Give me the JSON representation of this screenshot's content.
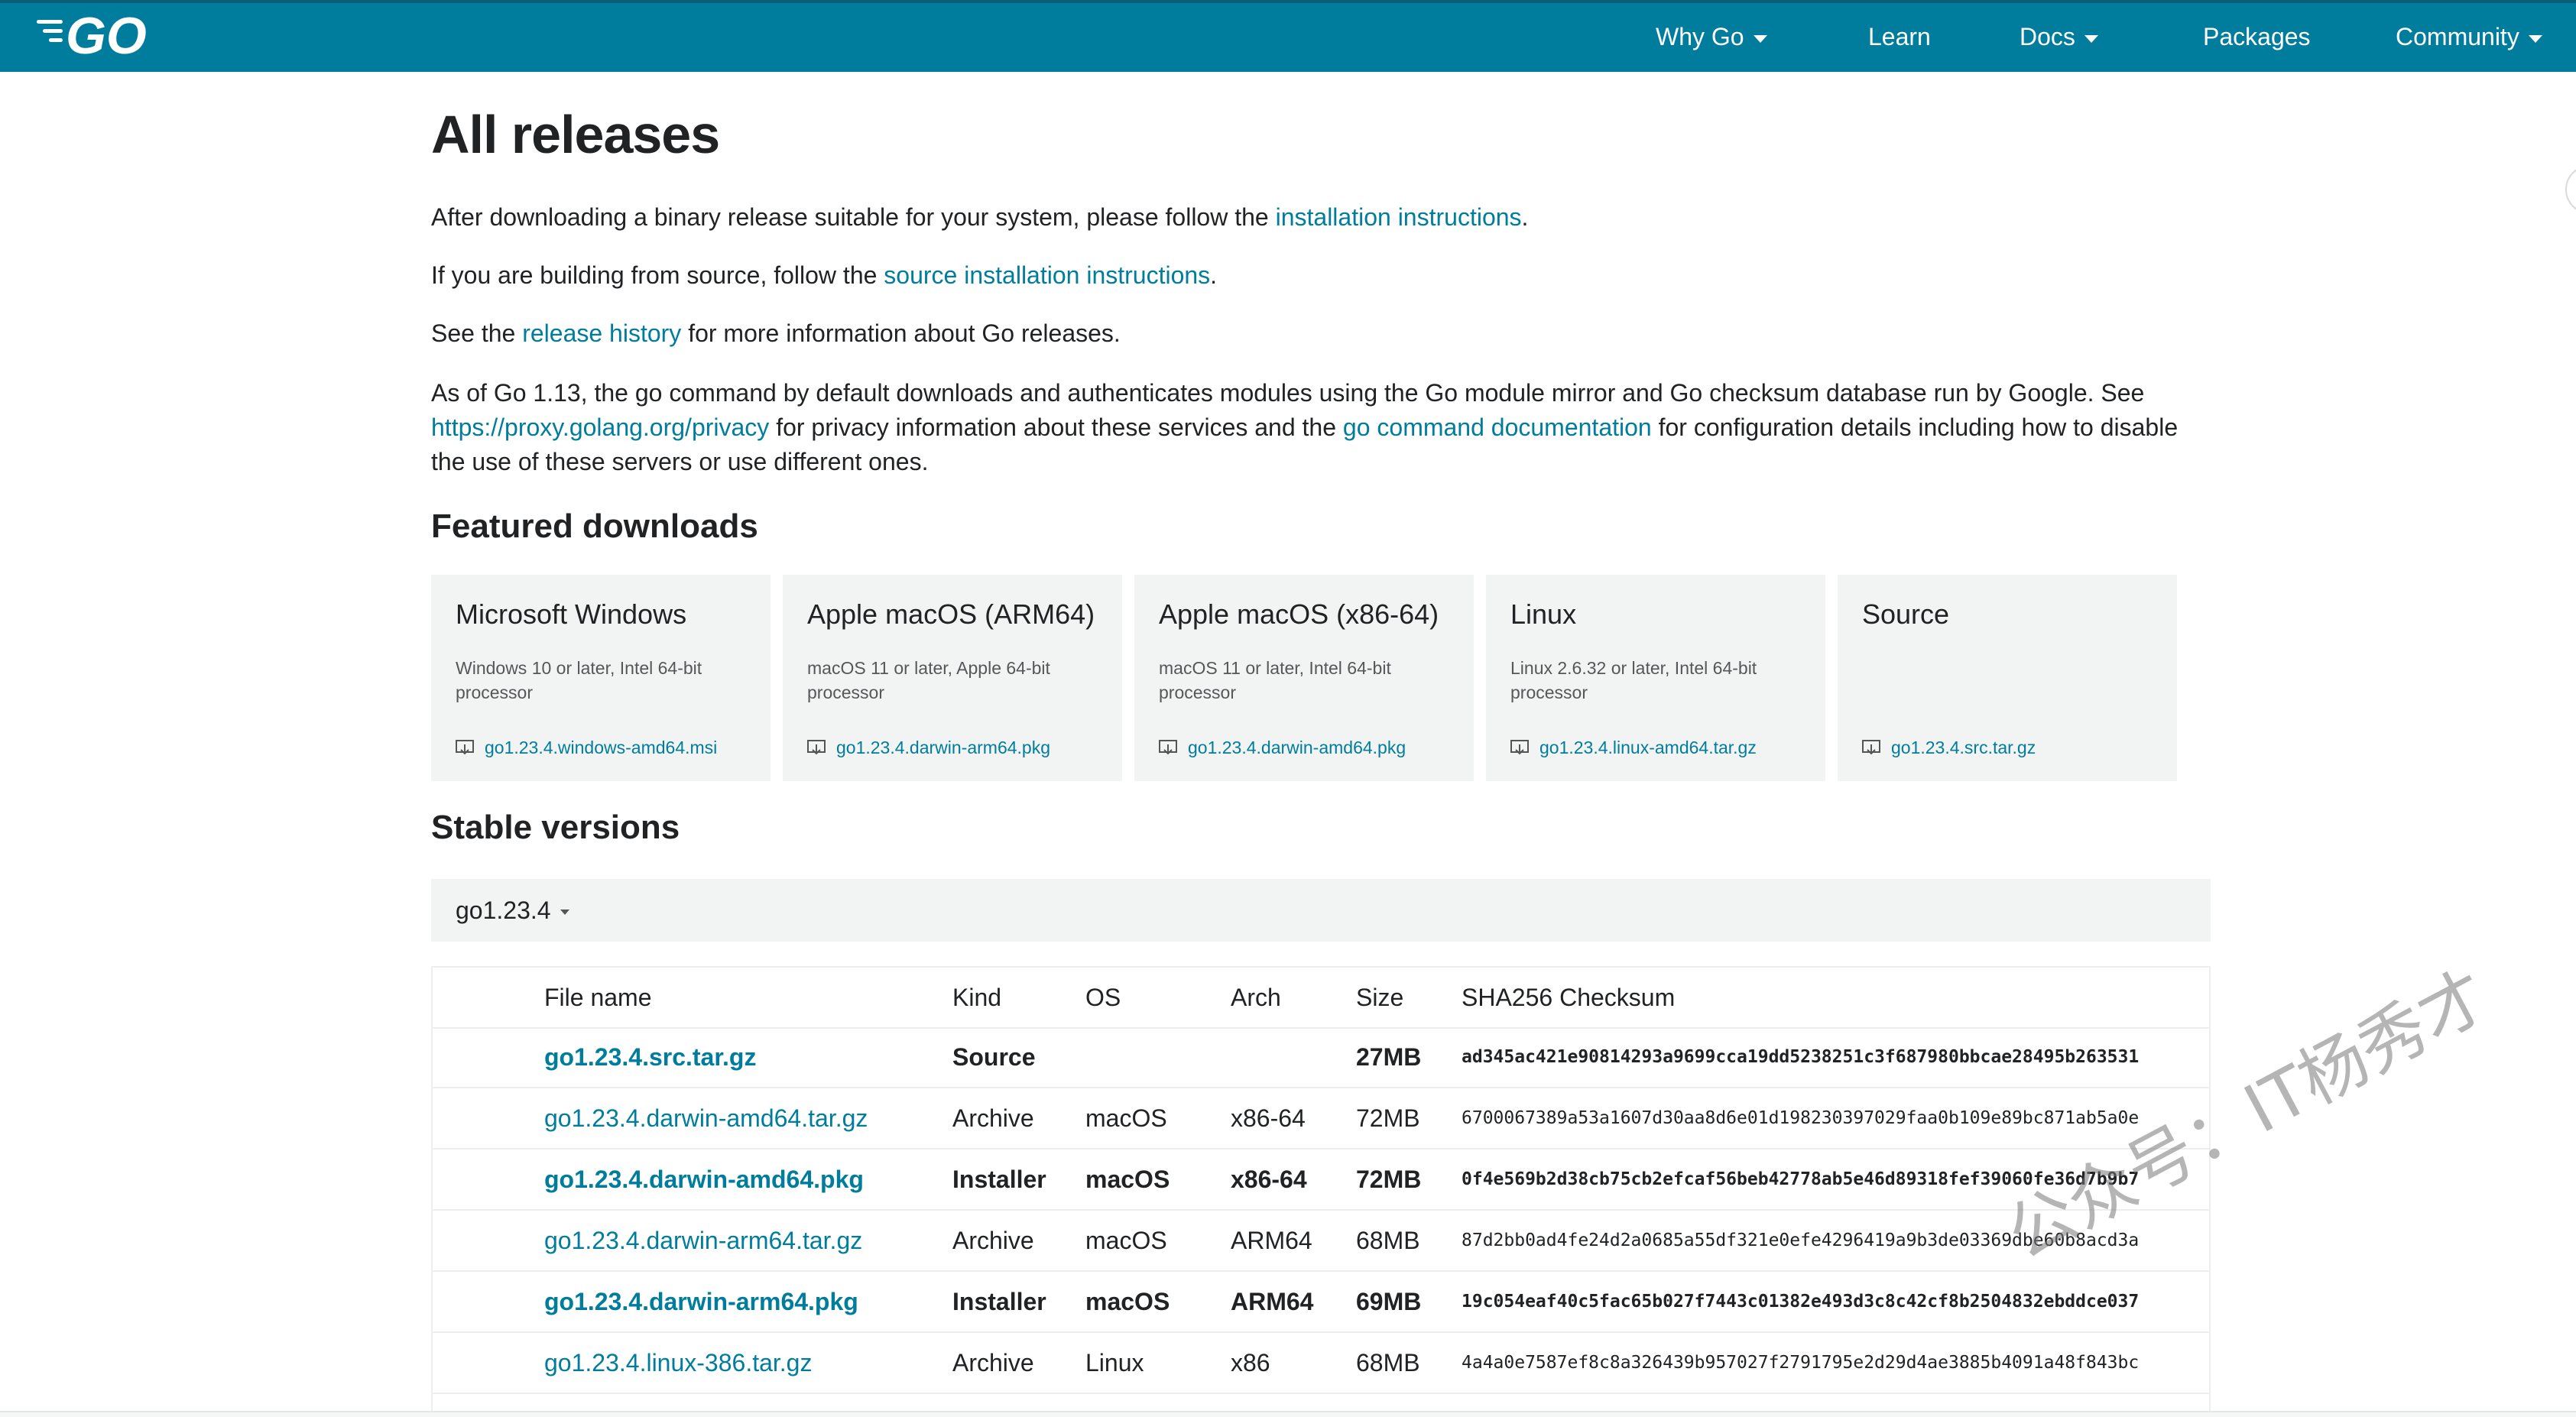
{
  "nav": {
    "items": [
      {
        "label": "Why Go",
        "has_dropdown": true
      },
      {
        "label": "Learn",
        "has_dropdown": false
      },
      {
        "label": "Docs",
        "has_dropdown": true
      },
      {
        "label": "Packages",
        "has_dropdown": false
      },
      {
        "label": "Community",
        "has_dropdown": true
      }
    ],
    "logo_icon": "go-logo-icon",
    "background": "#007d9c"
  },
  "page": {
    "title": "All releases",
    "p1": {
      "before": "After downloading a binary release suitable for your system, please follow the ",
      "link": "installation instructions",
      "after": "."
    },
    "p2": {
      "before": "If you are building from source, follow the ",
      "link": "source installation instructions",
      "after": "."
    },
    "p3": {
      "before": "See the ",
      "link": "release history",
      "after": " for more information about Go releases."
    },
    "p4": {
      "a": "As of Go 1.13, the go command by default downloads and authenticates modules using the Go module mirror and Go checksum database run by Google. See ",
      "link1": "https://proxy.golang.org/privacy",
      "b": " for privacy information about these services and the ",
      "link2": "go command documentation",
      "c": " for configuration details including how to disable the use of these servers or use different ones."
    }
  },
  "featured": {
    "heading": "Featured downloads",
    "cards": [
      {
        "title": "Microsoft Windows",
        "desc": "Windows 10 or later, Intel 64-bit processor",
        "file": "go1.23.4.windows-amd64.msi"
      },
      {
        "title": "Apple macOS (ARM64)",
        "desc": "macOS 11 or later, Apple 64-bit processor",
        "file": "go1.23.4.darwin-arm64.pkg"
      },
      {
        "title": "Apple macOS (x86-64)",
        "desc": "macOS 11 or later, Intel 64-bit processor",
        "file": "go1.23.4.darwin-amd64.pkg"
      },
      {
        "title": "Linux",
        "desc": "Linux 2.6.32 or later, Intel 64-bit processor",
        "file": "go1.23.4.linux-amd64.tar.gz"
      },
      {
        "title": "Source",
        "desc": "",
        "file": "go1.23.4.src.tar.gz"
      }
    ]
  },
  "stable": {
    "heading": "Stable versions",
    "version": "go1.23.4",
    "columns": [
      "File name",
      "Kind",
      "OS",
      "Arch",
      "Size",
      "SHA256 Checksum"
    ],
    "rows": [
      {
        "file": "go1.23.4.src.tar.gz",
        "kind": "Source",
        "os": "",
        "arch": "",
        "size": "27MB",
        "sha": "ad345ac421e90814293a9699cca19dd5238251c3f687980bbcae28495b263531",
        "featured": true
      },
      {
        "file": "go1.23.4.darwin-amd64.tar.gz",
        "kind": "Archive",
        "os": "macOS",
        "arch": "x86-64",
        "size": "72MB",
        "sha": "6700067389a53a1607d30aa8d6e01d198230397029faa0b109e89bc871ab5a0e",
        "featured": false
      },
      {
        "file": "go1.23.4.darwin-amd64.pkg",
        "kind": "Installer",
        "os": "macOS",
        "arch": "x86-64",
        "size": "72MB",
        "sha": "0f4e569b2d38cb75cb2efcaf56beb42778ab5e46d89318fef39060fe36d7b9b7",
        "featured": true
      },
      {
        "file": "go1.23.4.darwin-arm64.tar.gz",
        "kind": "Archive",
        "os": "macOS",
        "arch": "ARM64",
        "size": "68MB",
        "sha": "87d2bb0ad4fe24d2a0685a55df321e0efe4296419a9b3de03369dbe60b8acd3a",
        "featured": false
      },
      {
        "file": "go1.23.4.darwin-arm64.pkg",
        "kind": "Installer",
        "os": "macOS",
        "arch": "ARM64",
        "size": "69MB",
        "sha": "19c054eaf40c5fac65b027f7443c01382e493d3c8c42cf8b2504832ebddce037",
        "featured": true
      },
      {
        "file": "go1.23.4.linux-386.tar.gz",
        "kind": "Archive",
        "os": "Linux",
        "arch": "x86",
        "size": "68MB",
        "sha": "4a4a0e7587ef8c8a326439b957027f2791795e2d29d4ae3885b4091a48f843bc",
        "featured": false
      }
    ]
  },
  "watermark": "公众号：IT杨秀才",
  "colors": {
    "link": "#007d9c",
    "card_bg": "#f2f3f3",
    "text": "#202224"
  }
}
